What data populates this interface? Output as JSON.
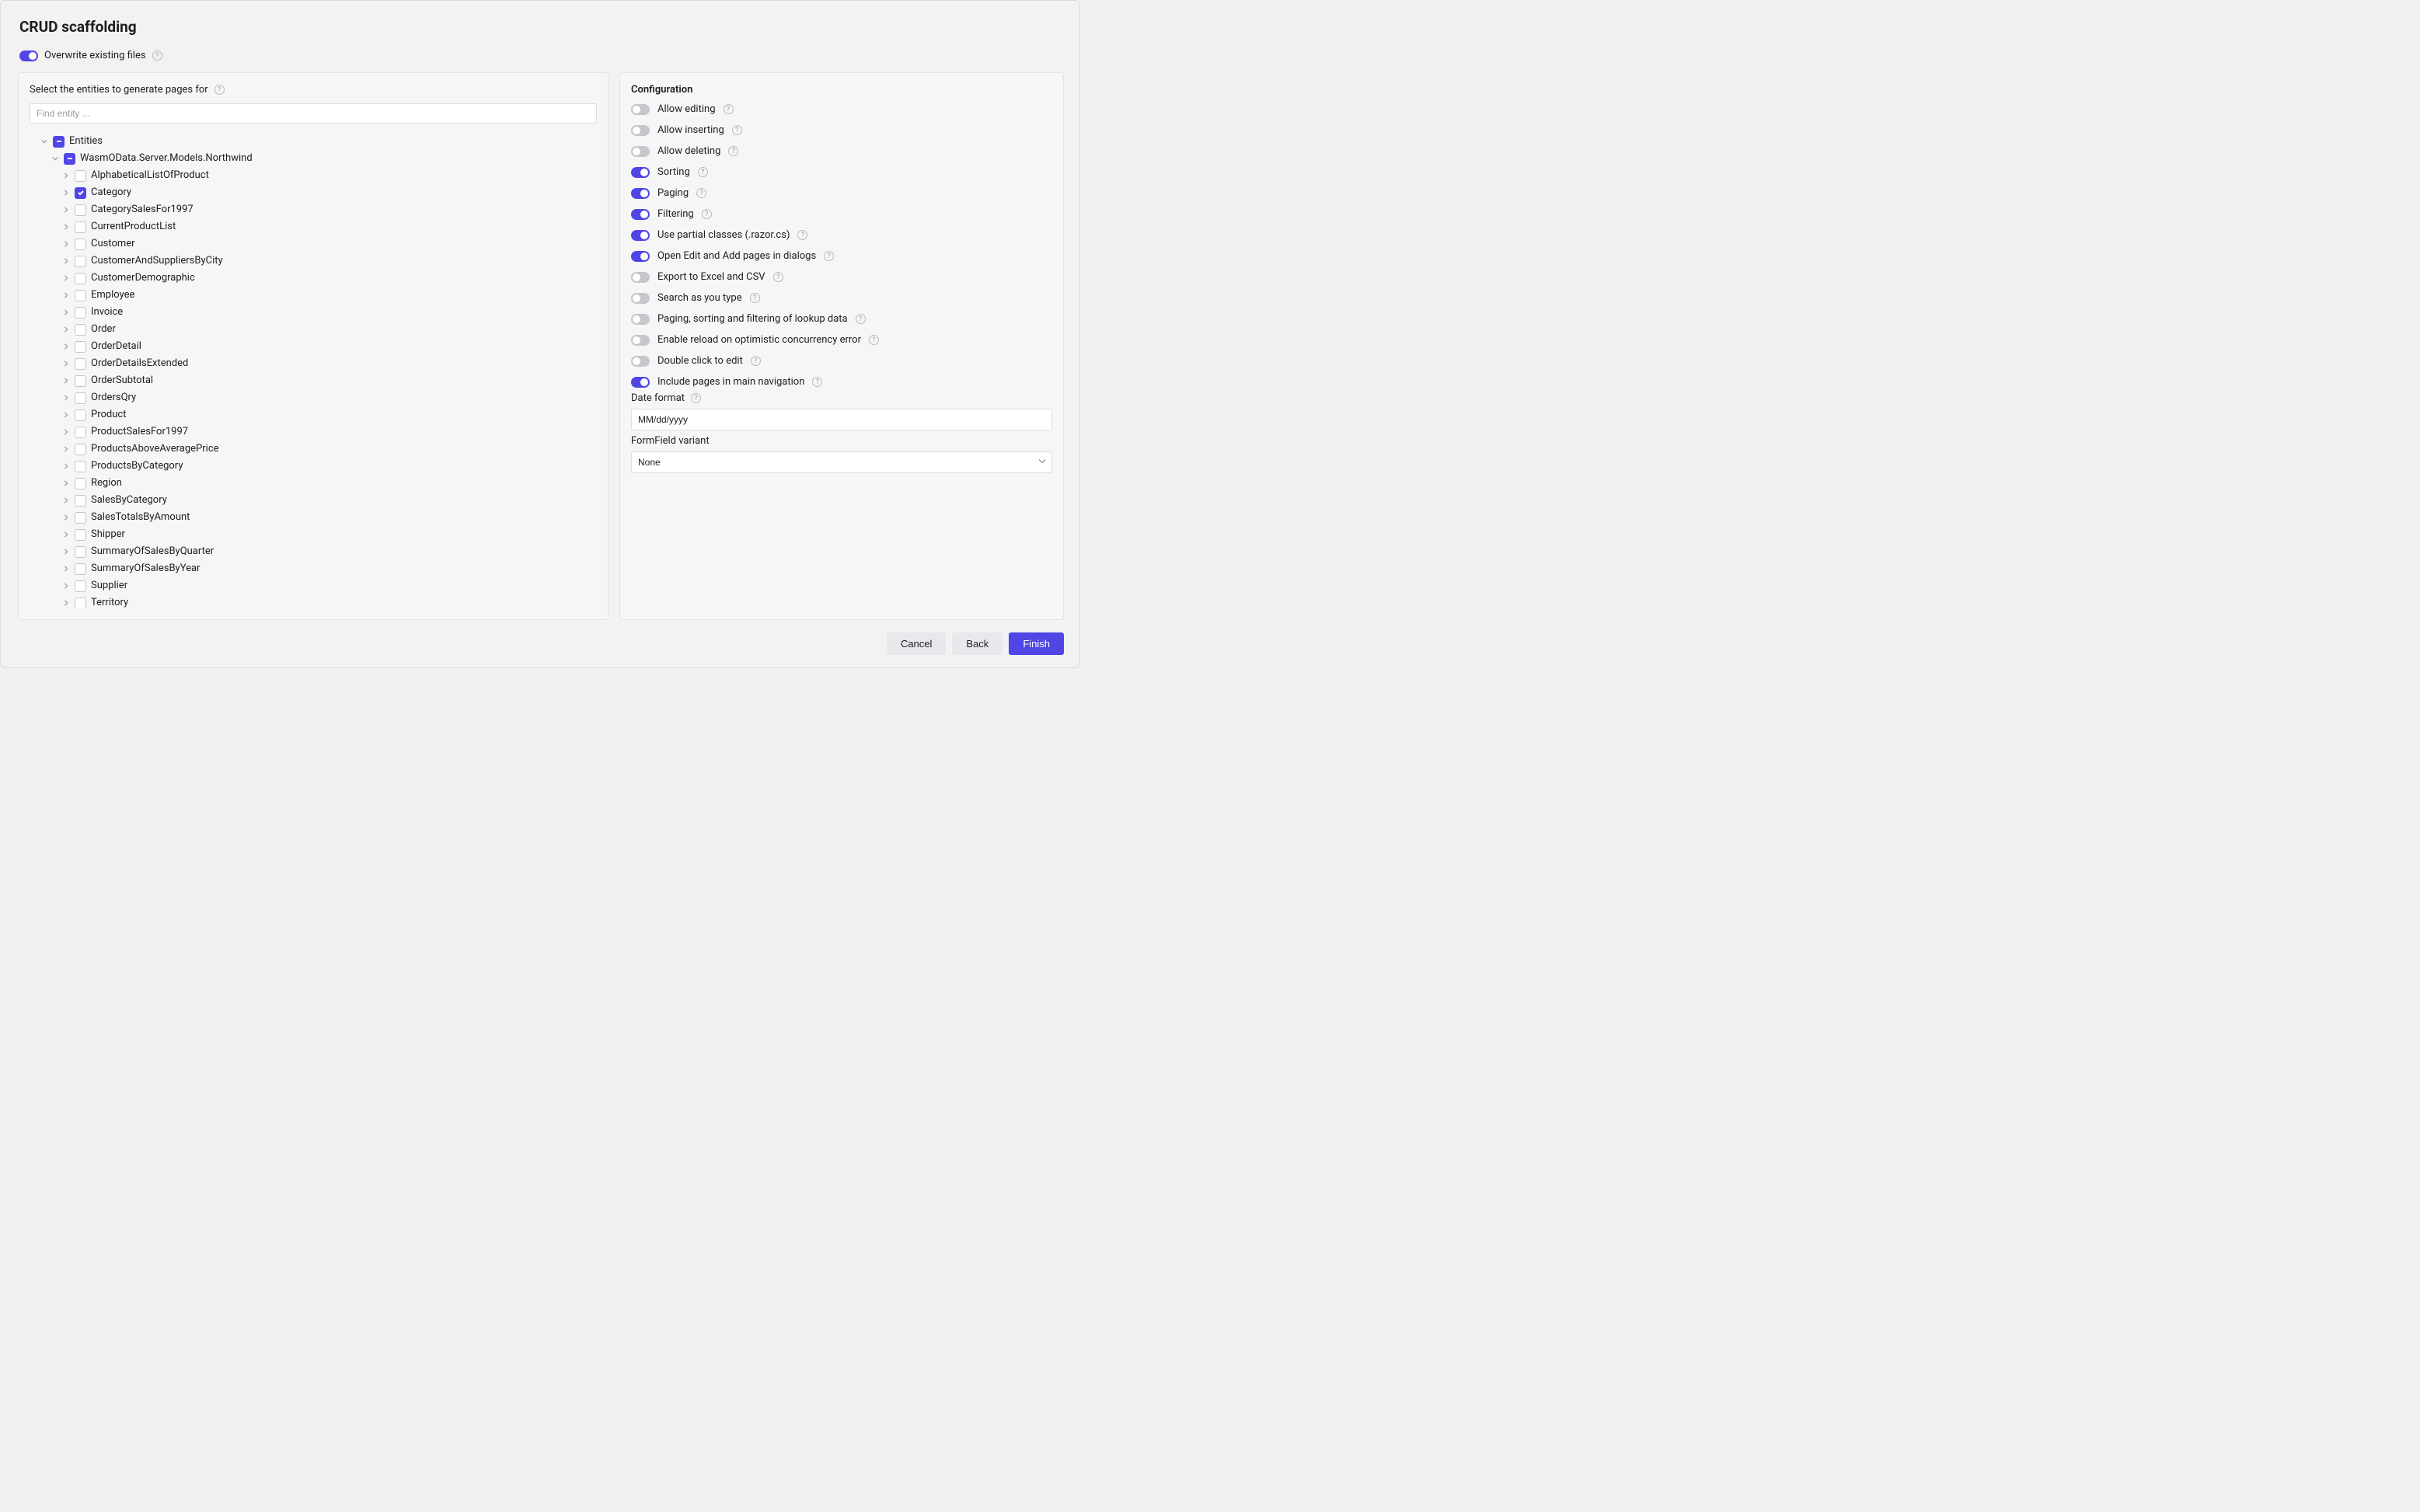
{
  "title": "CRUD scaffolding",
  "overwrite": {
    "label": "Overwrite existing files",
    "on": true
  },
  "left": {
    "heading": "Select the entities to generate pages for",
    "search_placeholder": "Find entity ...",
    "root_label": "Entities",
    "namespace_label": "WasmOData.Server.Models.Northwind",
    "entities": [
      {
        "label": "AlphabeticalListOfProduct",
        "checked": false
      },
      {
        "label": "Category",
        "checked": true
      },
      {
        "label": "CategorySalesFor1997",
        "checked": false
      },
      {
        "label": "CurrentProductList",
        "checked": false
      },
      {
        "label": "Customer",
        "checked": false
      },
      {
        "label": "CustomerAndSuppliersByCity",
        "checked": false
      },
      {
        "label": "CustomerDemographic",
        "checked": false
      },
      {
        "label": "Employee",
        "checked": false
      },
      {
        "label": "Invoice",
        "checked": false
      },
      {
        "label": "Order",
        "checked": false
      },
      {
        "label": "OrderDetail",
        "checked": false
      },
      {
        "label": "OrderDetailsExtended",
        "checked": false
      },
      {
        "label": "OrderSubtotal",
        "checked": false
      },
      {
        "label": "OrdersQry",
        "checked": false
      },
      {
        "label": "Product",
        "checked": false
      },
      {
        "label": "ProductSalesFor1997",
        "checked": false
      },
      {
        "label": "ProductsAboveAveragePrice",
        "checked": false
      },
      {
        "label": "ProductsByCategory",
        "checked": false
      },
      {
        "label": "Region",
        "checked": false
      },
      {
        "label": "SalesByCategory",
        "checked": false
      },
      {
        "label": "SalesTotalsByAmount",
        "checked": false
      },
      {
        "label": "Shipper",
        "checked": false
      },
      {
        "label": "SummaryOfSalesByQuarter",
        "checked": false
      },
      {
        "label": "SummaryOfSalesByYear",
        "checked": false
      },
      {
        "label": "Supplier",
        "checked": false
      },
      {
        "label": "Territory",
        "checked": false
      }
    ]
  },
  "right": {
    "heading": "Configuration",
    "options": [
      {
        "label": "Allow editing",
        "on": false
      },
      {
        "label": "Allow inserting",
        "on": false
      },
      {
        "label": "Allow deleting",
        "on": false
      },
      {
        "label": "Sorting",
        "on": true
      },
      {
        "label": "Paging",
        "on": true
      },
      {
        "label": "Filtering",
        "on": true
      },
      {
        "label": "Use partial classes (.razor.cs)",
        "on": true
      },
      {
        "label": "Open Edit and Add pages in dialogs",
        "on": true
      },
      {
        "label": "Export to Excel and CSV",
        "on": false
      },
      {
        "label": "Search as you type",
        "on": false
      },
      {
        "label": "Paging, sorting and filtering of lookup data",
        "on": false
      },
      {
        "label": "Enable reload on optimistic concurrency error",
        "on": false
      },
      {
        "label": "Double click to edit",
        "on": false
      },
      {
        "label": "Include pages in main navigation",
        "on": true
      }
    ],
    "date_format_label": "Date format",
    "date_format_value": "MM/dd/yyyy",
    "variant_label": "FormField variant",
    "variant_value": "None"
  },
  "footer": {
    "cancel": "Cancel",
    "back": "Back",
    "finish": "Finish"
  }
}
